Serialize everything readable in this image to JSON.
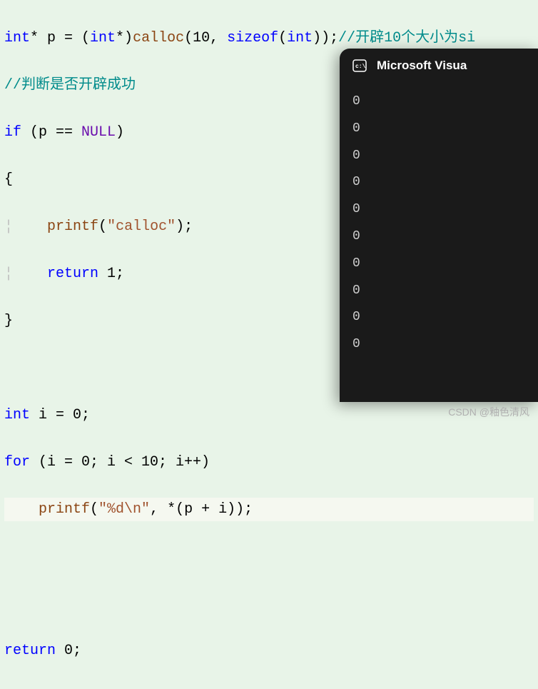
{
  "code": {
    "l1_p1": "int",
    "l1_p2": "* p = (",
    "l1_p3": "int",
    "l1_p4": "*)",
    "l1_p5": "calloc",
    "l1_p6": "(10, ",
    "l1_p7": "sizeof",
    "l1_p8": "(",
    "l1_p9": "int",
    "l1_p10": "));",
    "l1_c": "//开辟10个大小为si",
    "l2_c": "//判断是否开辟成功",
    "l3_p1": "if",
    "l3_p2": " (p == ",
    "l3_p3": "NULL",
    "l3_p4": ")",
    "l4": "{",
    "l5_p1": "    printf",
    "l5_p2": "(",
    "l5_p3": "\"calloc\"",
    "l5_p4": ");",
    "l6_p1": "    return",
    "l6_p2": " 1;",
    "l7": "}",
    "l9_p1": "int",
    "l9_p2": " i = 0;",
    "l10_p1": "for",
    "l10_p2": " (i = 0; i < 10; i++)",
    "l11_p1": "    printf",
    "l11_p2": "(",
    "l11_p3": "\"%d\\n\"",
    "l11_p4": ", *(p + i));",
    "l13_p1": "return",
    "l13_p2": " 0;"
  },
  "terminal": {
    "title": "Microsoft Visua",
    "output": [
      "0",
      "0",
      "0",
      "0",
      "0",
      "0",
      "0",
      "0",
      "0",
      "0"
    ]
  },
  "watermark": "CSDN @釉色清风"
}
